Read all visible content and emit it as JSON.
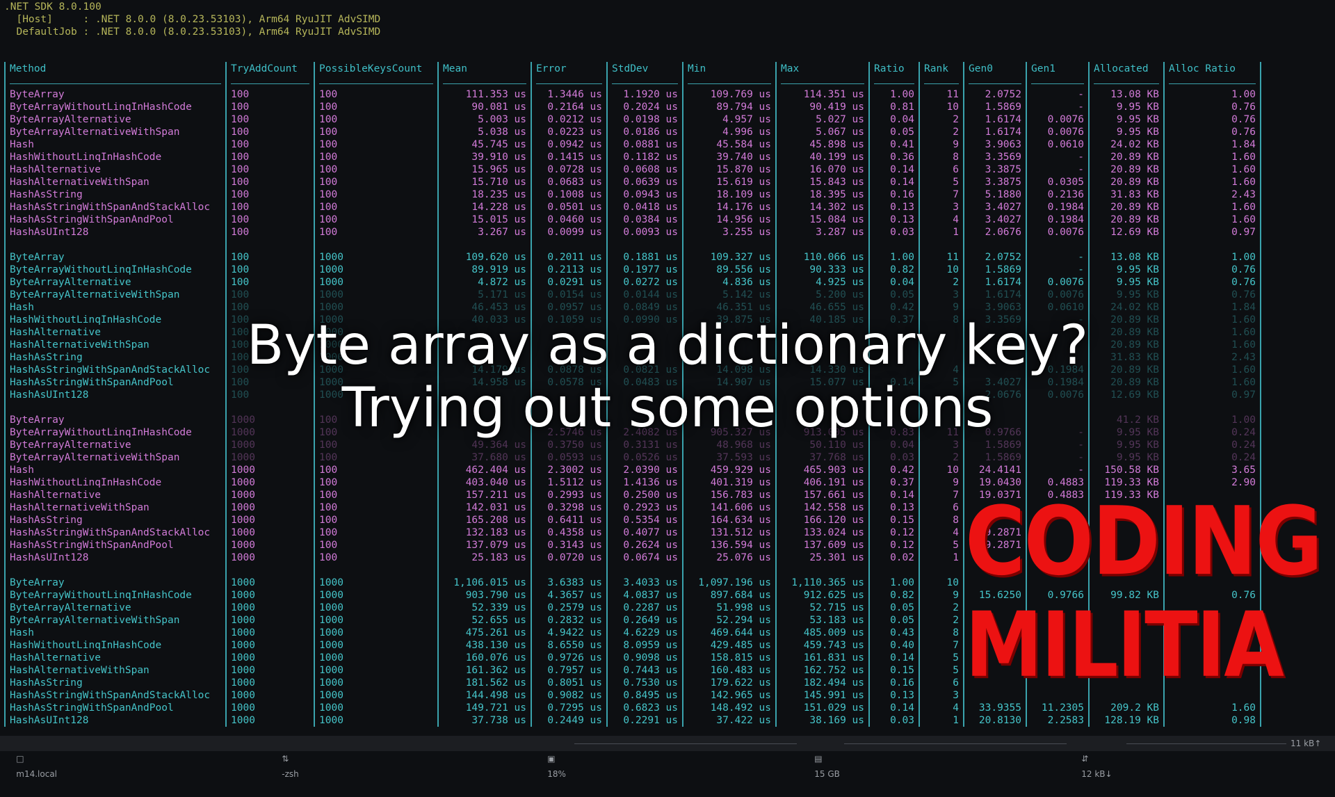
{
  "header_lines": [
    ".NET SDK 8.0.100",
    "  [Host]     : .NET 8.0.0 (8.0.23.53103), Arm64 RyuJIT AdvSIMD",
    "  DefaultJob : .NET 8.0.0 (8.0.23.53103), Arm64 RyuJIT AdvSIMD"
  ],
  "columns": [
    "Method",
    "TryAddCount",
    "PossibleKeysCount",
    "Mean",
    "Error",
    "StdDev",
    "Min",
    "Max",
    "Ratio",
    "Rank",
    "Gen0",
    "Gen1",
    "Allocated",
    "Alloc Ratio"
  ],
  "separator_row": [
    "-------------------------------------",
    "------------",
    "------------------",
    "-----------:",
    "----------:",
    "----------:",
    "-------------:",
    "-------------:",
    "-------:",
    "-----:",
    "---------:",
    "--------:",
    "-----------:",
    "-----------:"
  ],
  "groups": [
    {
      "color": "#d27bd8",
      "rows": [
        [
          "ByteArray",
          "100",
          "100",
          "111.353 us",
          "1.3446 us",
          "1.1920 us",
          "109.769 us",
          "114.351 us",
          "1.00",
          "11",
          "2.0752",
          "-",
          "13.08 KB",
          "1.00"
        ],
        [
          "ByteArrayWithoutLinqInHashCode",
          "100",
          "100",
          "90.081 us",
          "0.2164 us",
          "0.2024 us",
          "89.794 us",
          "90.419 us",
          "0.81",
          "10",
          "1.5869",
          "-",
          "9.95 KB",
          "0.76"
        ],
        [
          "ByteArrayAlternative",
          "100",
          "100",
          "5.003 us",
          "0.0212 us",
          "0.0198 us",
          "4.957 us",
          "5.027 us",
          "0.04",
          "2",
          "1.6174",
          "0.0076",
          "9.95 KB",
          "0.76"
        ],
        [
          "ByteArrayAlternativeWithSpan",
          "100",
          "100",
          "5.038 us",
          "0.0223 us",
          "0.0186 us",
          "4.996 us",
          "5.067 us",
          "0.05",
          "2",
          "1.6174",
          "0.0076",
          "9.95 KB",
          "0.76"
        ],
        [
          "Hash",
          "100",
          "100",
          "45.745 us",
          "0.0942 us",
          "0.0881 us",
          "45.584 us",
          "45.898 us",
          "0.41",
          "9",
          "3.9063",
          "0.0610",
          "24.02 KB",
          "1.84"
        ],
        [
          "HashWithoutLinqInHashCode",
          "100",
          "100",
          "39.910 us",
          "0.1415 us",
          "0.1182 us",
          "39.740 us",
          "40.199 us",
          "0.36",
          "8",
          "3.3569",
          "-",
          "20.89 KB",
          "1.60"
        ],
        [
          "HashAlternative",
          "100",
          "100",
          "15.965 us",
          "0.0728 us",
          "0.0608 us",
          "15.870 us",
          "16.070 us",
          "0.14",
          "6",
          "3.3875",
          "-",
          "20.89 KB",
          "1.60"
        ],
        [
          "HashAlternativeWithSpan",
          "100",
          "100",
          "15.710 us",
          "0.0683 us",
          "0.0639 us",
          "15.619 us",
          "15.843 us",
          "0.14",
          "5",
          "3.3875",
          "0.0305",
          "20.89 KB",
          "1.60"
        ],
        [
          "HashAsString",
          "100",
          "100",
          "18.235 us",
          "0.1008 us",
          "0.0943 us",
          "18.109 us",
          "18.395 us",
          "0.16",
          "7",
          "5.1880",
          "0.2136",
          "31.83 KB",
          "2.43"
        ],
        [
          "HashAsStringWithSpanAndStackAlloc",
          "100",
          "100",
          "14.228 us",
          "0.0501 us",
          "0.0418 us",
          "14.176 us",
          "14.302 us",
          "0.13",
          "3",
          "3.4027",
          "0.1984",
          "20.89 KB",
          "1.60"
        ],
        [
          "HashAsStringWithSpanAndPool",
          "100",
          "100",
          "15.015 us",
          "0.0460 us",
          "0.0384 us",
          "14.956 us",
          "15.084 us",
          "0.13",
          "4",
          "3.4027",
          "0.1984",
          "20.89 KB",
          "1.60"
        ],
        [
          "HashAsUInt128",
          "100",
          "100",
          "3.267 us",
          "0.0099 us",
          "0.0093 us",
          "3.255 us",
          "3.287 us",
          "0.03",
          "1",
          "2.0676",
          "0.0076",
          "12.69 KB",
          "0.97"
        ]
      ]
    },
    {
      "color": "#45c4c9",
      "rows": [
        [
          "ByteArray",
          "100",
          "1000",
          "109.620 us",
          "0.2011 us",
          "0.1881 us",
          "109.327 us",
          "110.066 us",
          "1.00",
          "11",
          "2.0752",
          "-",
          "13.08 KB",
          "1.00"
        ],
        [
          "ByteArrayWithoutLinqInHashCode",
          "100",
          "1000",
          "89.919 us",
          "0.2113 us",
          "0.1977 us",
          "89.556 us",
          "90.333 us",
          "0.82",
          "10",
          "1.5869",
          "-",
          "9.95 KB",
          "0.76"
        ],
        [
          "ByteArrayAlternative",
          "100",
          "1000",
          "4.872 us",
          "0.0291 us",
          "0.0272 us",
          "4.836 us",
          "4.925 us",
          "0.04",
          "2",
          "1.6174",
          "0.0076",
          "9.95 KB",
          "0.76"
        ],
        [
          "ByteArrayAlternativeWithSpan",
          "100",
          "1000",
          "5.171 us",
          "0.0154 us",
          "0.0144 us",
          "5.142 us",
          "5.200 us",
          "0.05",
          "3",
          "1.6174",
          "0.0076",
          "9.95 KB",
          "0.76"
        ],
        [
          "Hash",
          "100",
          "1000",
          "46.453 us",
          "0.0957 us",
          "0.0849 us",
          "46.351 us",
          "46.655 us",
          "0.42",
          "9",
          "3.9063",
          "0.0610",
          "24.02 KB",
          "1.84"
        ],
        [
          "HashWithoutLinqInHashCode",
          "100",
          "1000",
          "40.033 us",
          "0.1059 us",
          "0.0990 us",
          "39.875 us",
          "40.185 us",
          "0.37",
          "8",
          "3.3569",
          "-",
          "20.89 KB",
          "1.60"
        ],
        [
          "HashAlternative",
          "100",
          "1000",
          "",
          "",
          "",
          "",
          "",
          "",
          "",
          "",
          "",
          "20.89 KB",
          "1.60"
        ],
        [
          "HashAlternativeWithSpan",
          "100",
          "1000",
          "",
          "",
          "",
          "",
          "",
          "",
          "",
          "",
          "",
          "20.89 KB",
          "1.60"
        ],
        [
          "HashAsString",
          "100",
          "1000",
          "",
          "",
          "",
          "",
          "",
          "",
          "",
          "",
          "",
          "31.83 KB",
          "2.43"
        ],
        [
          "HashAsStringWithSpanAndStackAlloc",
          "100",
          "1000",
          "14.179 us",
          "0.0878 us",
          "0.0821 us",
          "14.098 us",
          "14.330 us",
          "",
          "4",
          "",
          "0.1984",
          "20.89 KB",
          "1.60"
        ],
        [
          "HashAsStringWithSpanAndPool",
          "100",
          "1000",
          "14.958 us",
          "0.0578 us",
          "0.0483 us",
          "14.907 us",
          "15.077 us",
          "0.14",
          "5",
          "3.4027",
          "0.1984",
          "20.89 KB",
          "1.60"
        ],
        [
          "HashAsUInt128",
          "100",
          "1000",
          "",
          "",
          "",
          "",
          "",
          "",
          "",
          "2.0676",
          "0.0076",
          "12.69 KB",
          "0.97"
        ]
      ]
    },
    {
      "color": "#d27bd8",
      "rows": [
        [
          "ByteArray",
          "1000",
          "100",
          "",
          "",
          "",
          "",
          "",
          "",
          "",
          "",
          "",
          "41.2 KB",
          "1.00"
        ],
        [
          "ByteArrayWithoutLinqInHashCode",
          "1000",
          "100",
          "",
          "2.5746 us",
          "2.4082 us",
          "905.327 us",
          "913.005 us",
          "0.83",
          "11",
          "0.9766",
          "-",
          "9.95 KB",
          "0.24"
        ],
        [
          "ByteArrayAlternative",
          "1000",
          "100",
          "49.364 us",
          "0.3750 us",
          "0.3131 us",
          "48.968 us",
          "50.110 us",
          "0.04",
          "3",
          "1.5869",
          "-",
          "9.95 KB",
          "0.24"
        ],
        [
          "ByteArrayAlternativeWithSpan",
          "1000",
          "100",
          "37.680 us",
          "0.0593 us",
          "0.0526 us",
          "37.593 us",
          "37.768 us",
          "0.03",
          "2",
          "1.5869",
          "-",
          "9.95 KB",
          "0.24"
        ],
        [
          "Hash",
          "1000",
          "100",
          "462.404 us",
          "2.3002 us",
          "2.0390 us",
          "459.929 us",
          "465.903 us",
          "0.42",
          "10",
          "24.4141",
          "-",
          "150.58 KB",
          "3.65"
        ],
        [
          "HashWithoutLinqInHashCode",
          "1000",
          "100",
          "403.040 us",
          "1.5112 us",
          "1.4136 us",
          "401.319 us",
          "406.191 us",
          "0.37",
          "9",
          "19.0430",
          "0.4883",
          "119.33 KB",
          "2.90"
        ],
        [
          "HashAlternative",
          "1000",
          "100",
          "157.211 us",
          "0.2993 us",
          "0.2500 us",
          "156.783 us",
          "157.661 us",
          "0.14",
          "7",
          "19.0371",
          "0.4883",
          "119.33 KB",
          ""
        ],
        [
          "HashAlternativeWithSpan",
          "1000",
          "100",
          "142.031 us",
          "0.3298 us",
          "0.2923 us",
          "141.606 us",
          "142.558 us",
          "0.13",
          "6",
          "",
          "",
          "",
          ""
        ],
        [
          "HashAsString",
          "1000",
          "100",
          "165.208 us",
          "0.6411 us",
          "0.5354 us",
          "164.634 us",
          "166.120 us",
          "0.15",
          "8",
          "",
          "",
          "",
          ""
        ],
        [
          "HashAsStringWithSpanAndStackAlloc",
          "1000",
          "100",
          "132.183 us",
          "0.4358 us",
          "0.4077 us",
          "131.512 us",
          "133.024 us",
          "0.12",
          "4",
          "19.2871",
          "",
          "",
          ""
        ],
        [
          "HashAsStringWithSpanAndPool",
          "1000",
          "100",
          "137.079 us",
          "0.3143 us",
          "0.2624 us",
          "136.594 us",
          "137.609 us",
          "0.12",
          "5",
          "19.2871",
          "",
          "",
          ""
        ],
        [
          "HashAsUInt128",
          "1000",
          "100",
          "25.183 us",
          "0.0720 us",
          "0.0674 us",
          "25.076 us",
          "25.301 us",
          "0.02",
          "1",
          "",
          "",
          "",
          ""
        ]
      ]
    },
    {
      "color": "#45c4c9",
      "rows": [
        [
          "ByteArray",
          "1000",
          "1000",
          "1,106.015 us",
          "3.6383 us",
          "3.4033 us",
          "1,097.196 us",
          "1,110.365 us",
          "1.00",
          "10",
          "",
          "",
          "",
          ""
        ],
        [
          "ByteArrayWithoutLinqInHashCode",
          "1000",
          "1000",
          "903.790 us",
          "4.3657 us",
          "4.0837 us",
          "897.684 us",
          "912.625 us",
          "0.82",
          "9",
          "15.6250",
          "0.9766",
          "99.82 KB",
          "0.76"
        ],
        [
          "ByteArrayAlternative",
          "1000",
          "1000",
          "52.339 us",
          "0.2579 us",
          "0.2287 us",
          "51.998 us",
          "52.715 us",
          "0.05",
          "2",
          "",
          "",
          "",
          ""
        ],
        [
          "ByteArrayAlternativeWithSpan",
          "1000",
          "1000",
          "52.655 us",
          "0.2832 us",
          "0.2649 us",
          "52.294 us",
          "53.183 us",
          "0.05",
          "2",
          "",
          "",
          "",
          ""
        ],
        [
          "Hash",
          "1000",
          "1000",
          "475.261 us",
          "4.9422 us",
          "4.6229 us",
          "469.644 us",
          "485.009 us",
          "0.43",
          "8",
          "",
          "",
          "",
          ""
        ],
        [
          "HashWithoutLinqInHashCode",
          "1000",
          "1000",
          "438.130 us",
          "8.6550 us",
          "8.0959 us",
          "429.485 us",
          "459.743 us",
          "0.40",
          "7",
          "",
          "",
          "",
          ""
        ],
        [
          "HashAlternative",
          "1000",
          "1000",
          "160.076 us",
          "0.9726 us",
          "0.9098 us",
          "158.815 us",
          "161.831 us",
          "0.14",
          "5",
          "",
          "",
          "",
          ""
        ],
        [
          "HashAlternativeWithSpan",
          "1000",
          "1000",
          "161.362 us",
          "0.7957 us",
          "0.7443 us",
          "160.483 us",
          "162.752 us",
          "0.15",
          "5",
          "",
          "",
          "",
          ""
        ],
        [
          "HashAsString",
          "1000",
          "1000",
          "181.562 us",
          "0.8051 us",
          "0.7530 us",
          "179.622 us",
          "182.494 us",
          "0.16",
          "6",
          "",
          "",
          "",
          ""
        ],
        [
          "HashAsStringWithSpanAndStackAlloc",
          "1000",
          "1000",
          "144.498 us",
          "0.9082 us",
          "0.8495 us",
          "142.965 us",
          "145.991 us",
          "0.13",
          "3",
          "",
          "",
          "",
          ""
        ],
        [
          "HashAsStringWithSpanAndPool",
          "1000",
          "1000",
          "149.721 us",
          "0.7295 us",
          "0.6823 us",
          "148.492 us",
          "151.029 us",
          "0.14",
          "4",
          "33.9355",
          "11.2305",
          "209.2 KB",
          "1.60"
        ],
        [
          "HashAsUInt128",
          "1000",
          "1000",
          "37.738 us",
          "0.2449 us",
          "0.2291 us",
          "37.422 us",
          "38.169 us",
          "0.03",
          "1",
          "20.8130",
          "2.2583",
          "128.19 KB",
          "0.98"
        ]
      ]
    }
  ],
  "overlay": {
    "line1": "Byte array as a dictionary key?",
    "line2": "Trying out some options"
  },
  "logo": {
    "line1": "CODING",
    "line2": "MILITIA",
    "color": "#ec1212"
  },
  "statusbar": {
    "host": "m14.local",
    "shell": "-zsh",
    "cpu": "18%",
    "memory": "15 GB",
    "net_down": "12 kB↓",
    "net_up": "11 kB↑"
  },
  "colors": {
    "magenta": "#d27bd8",
    "cyan": "#45c4c9",
    "header_yellow": "#b6b65a",
    "background": "#0d0f12"
  }
}
